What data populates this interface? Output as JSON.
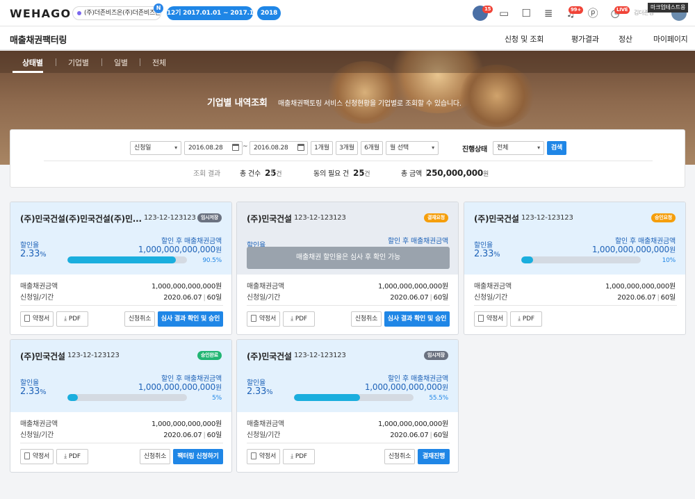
{
  "header": {
    "logo": "WEHAGO",
    "company": "(주)더존비즈온(주)더존비즈온...",
    "new_badge": "N",
    "period": "12기 2017.01.01 ~ 2017.12.31",
    "year": "2018",
    "avatar_badge": "15",
    "bell_badge": "99+",
    "live_badge": "LIVE",
    "tooltip": "마크업테스트용",
    "user_name": "김더존님"
  },
  "subnav": {
    "title": "매출채권팩터링",
    "menu": [
      "신청 및 조회",
      "평가결과",
      "정산",
      "마이페이지"
    ]
  },
  "hero": {
    "tabs": [
      "상태별",
      "기업별",
      "일별",
      "전체"
    ],
    "active_tab": "상태별",
    "title": "기업별 내역조회",
    "desc": "매출채권팩토링 서비스 신청현황을 기업별로 조회할 수 있습니다."
  },
  "filter": {
    "date_type": "신청일",
    "date_from": "2016.08.28",
    "tilde": "~",
    "date_to": "2016.08.28",
    "period_buttons": [
      "1개월",
      "3개월",
      "6개월"
    ],
    "month_select": "월 선택",
    "status_label": "진행상태",
    "status_value": "전체",
    "search": "검색",
    "result_label": "조회 결과",
    "total_label": "총 건수",
    "total_value": "25",
    "unit_count": "건",
    "consent_label": "동의 필요 건",
    "consent_value": "25",
    "amount_label": "총 금액",
    "amount_value": "250,000,000",
    "unit_won": "원"
  },
  "card_labels": {
    "rate": "할인율",
    "amount_after": "할인 후 매출채권금액",
    "receivable": "매출채권금액",
    "date_period": "신청일/기간",
    "contract": "약정서",
    "pdf": "PDF",
    "cancel": "신청취소",
    "locked": "매출채권 할인율은 심사 후 확인 가능"
  },
  "cards": [
    {
      "name": "(주)민국건설(주)민국건설(주)민...",
      "regno": "123-12-123123",
      "status": "임시저장",
      "status_color": "#6b7280",
      "rate": "2.33",
      "pct": "%",
      "amount": "1,000,000,000,000",
      "won": "원",
      "progress": 0.905,
      "progress_label": "90.5%",
      "receivable": "1,000,000,000,000원",
      "date": "2020.06.07",
      "days": "60일",
      "cancel": true,
      "action": "심사 결과 확인 및 승인",
      "locked": false,
      "gray": false
    },
    {
      "name": "(주)민국건설",
      "regno": "123-12-123123",
      "status": "결재요청",
      "status_color": "#f59e0b",
      "rate": "",
      "pct": "",
      "amount": "",
      "won": "",
      "progress": 0,
      "progress_label": "",
      "receivable": "1,000,000,000,000원",
      "date": "2020.06.07",
      "days": "60일",
      "cancel": true,
      "action": "심사 결과 확인 및 승인",
      "locked": true,
      "gray": true
    },
    {
      "name": "(주)민국건설",
      "regno": "123-12-123123",
      "status": "승인요청",
      "status_color": "#f59e0b",
      "rate": "2.33",
      "pct": "%",
      "amount": "1,000,000,000,000",
      "won": "원",
      "progress": 0.1,
      "progress_label": "10%",
      "receivable": "1,000,000,000,000원",
      "date": "2020.06.07",
      "days": "60일",
      "cancel": false,
      "action": "",
      "locked": false,
      "gray": false
    },
    {
      "name": "(주)민국건설",
      "regno": "123-12-123123",
      "status": "승인완료",
      "status_color": "#22b573",
      "rate": "2.33",
      "pct": "%",
      "amount": "1,000,000,000,000",
      "won": "원",
      "progress": 0.05,
      "progress_label": "5%",
      "receivable": "1,000,000,000,000원",
      "date": "2020.06.07",
      "days": "60일",
      "cancel": true,
      "action": "팩터링 신청하기",
      "locked": false,
      "gray": false
    },
    {
      "name": "(주)민국건설",
      "regno": "123-12-123123",
      "status": "임시저장",
      "status_color": "#6b7280",
      "rate": "2.33",
      "pct": "%",
      "amount": "1,000,000,000,000",
      "won": "원",
      "progress": 0.555,
      "progress_label": "55.5%",
      "receivable": "1,000,000,000,000원",
      "date": "2020.06.07",
      "days": "60일",
      "cancel": true,
      "action": "결재진행",
      "locked": false,
      "gray": false
    }
  ]
}
